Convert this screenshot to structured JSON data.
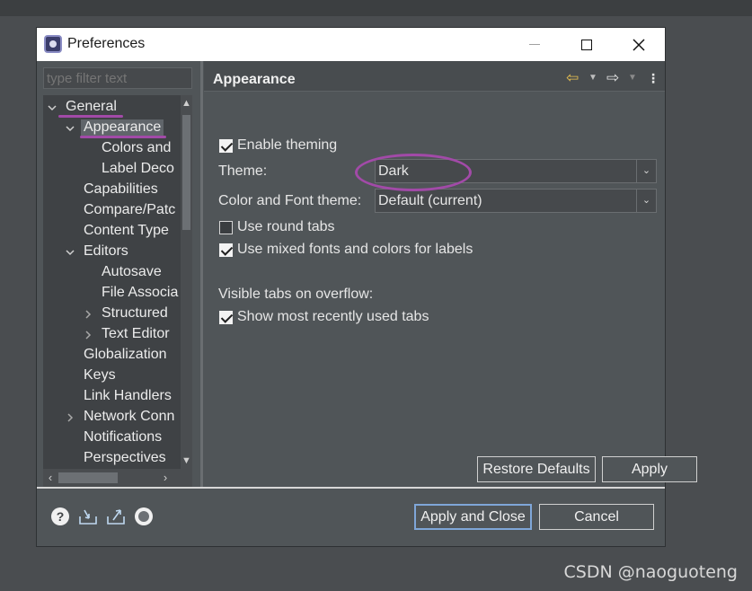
{
  "window": {
    "title": "Preferences",
    "controls": {
      "minimize": "minimize",
      "maximize": "maximize",
      "close": "close"
    }
  },
  "filter": {
    "placeholder": "type filter text"
  },
  "tree": [
    {
      "label": "General",
      "expand": "expanded",
      "level": 0
    },
    {
      "label": "Appearance",
      "expand": "expanded",
      "level": 1,
      "selected": true
    },
    {
      "label": "Colors and",
      "expand": "none",
      "level": 2
    },
    {
      "label": "Label Deco",
      "expand": "none",
      "level": 2
    },
    {
      "label": "Capabilities",
      "expand": "none",
      "level": 1
    },
    {
      "label": "Compare/Patc",
      "expand": "none",
      "level": 1
    },
    {
      "label": "Content Type",
      "expand": "none",
      "level": 1
    },
    {
      "label": "Editors",
      "expand": "expanded",
      "level": 1
    },
    {
      "label": "Autosave",
      "expand": "none",
      "level": 2
    },
    {
      "label": "File Associa",
      "expand": "none",
      "level": 2
    },
    {
      "label": "Structured",
      "expand": "collapsed",
      "level": 2
    },
    {
      "label": "Text Editor",
      "expand": "collapsed",
      "level": 2
    },
    {
      "label": "Globalization",
      "expand": "none",
      "level": 1
    },
    {
      "label": "Keys",
      "expand": "none",
      "level": 1
    },
    {
      "label": "Link Handlers",
      "expand": "none",
      "level": 1
    },
    {
      "label": "Network Conn",
      "expand": "collapsed",
      "level": 1
    },
    {
      "label": "Notifications",
      "expand": "none",
      "level": 1
    },
    {
      "label": "Perspectives",
      "expand": "none",
      "level": 1
    }
  ],
  "page": {
    "title": "Appearance",
    "enable_theming": {
      "label": "Enable theming",
      "checked": true
    },
    "theme": {
      "label": "Theme:",
      "value": "Dark"
    },
    "color_font_theme": {
      "label": "Color and Font theme:",
      "value": "Default (current)"
    },
    "round_tabs": {
      "label": "Use round tabs",
      "checked": false
    },
    "mixed_fonts": {
      "label": "Use mixed fonts and colors for labels",
      "checked": true
    },
    "visible_tabs_label": "Visible tabs on overflow:",
    "recent_tabs": {
      "label": "Show most recently used tabs",
      "checked": true
    },
    "restore_defaults": "Restore Defaults",
    "apply": "Apply"
  },
  "footer": {
    "apply_close": "Apply and Close",
    "cancel": "Cancel",
    "help_glyph": "?"
  },
  "icons": [
    "app-icon",
    "minimize-icon",
    "maximize-icon",
    "close-icon",
    "back-arrow-icon",
    "forward-arrow-icon",
    "view-menu-icon",
    "help-icon",
    "import-icon",
    "export-icon",
    "oomph-icon"
  ],
  "colors": {
    "background": "#4a4d50",
    "dialog": "#505558",
    "annotation": "#a24aa8",
    "focus_border": "#7fa6d8"
  },
  "watermark": "CSDN @naoguoteng"
}
